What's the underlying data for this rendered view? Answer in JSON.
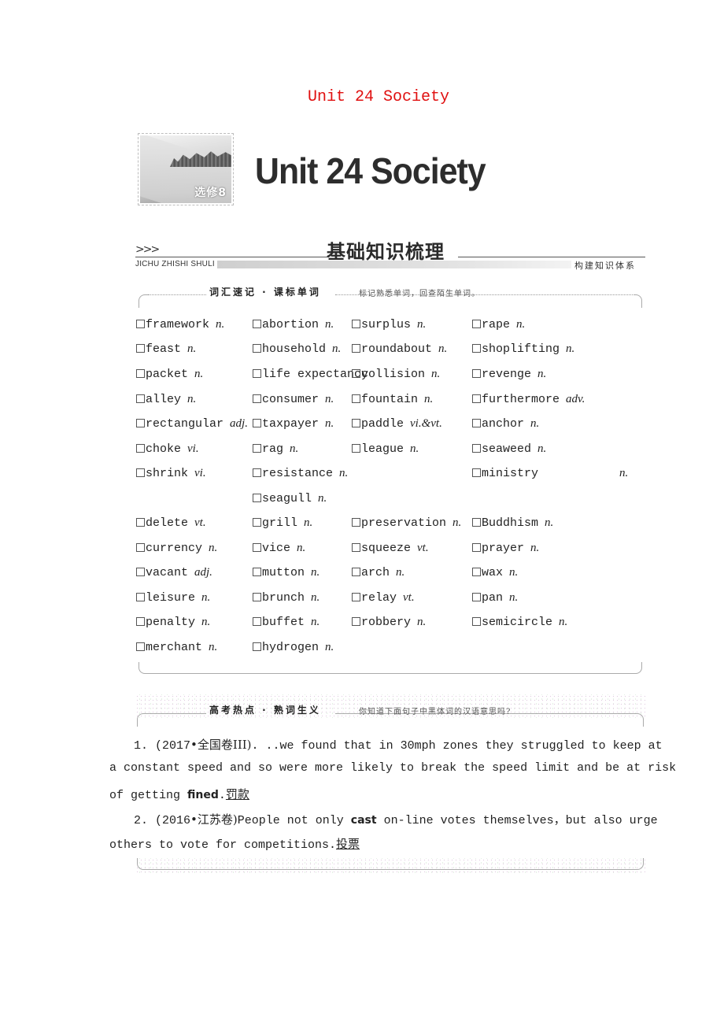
{
  "document": {
    "title": "Unit 24 Society",
    "banner": {
      "image_tag": "选修8",
      "image_icon": "snow-landscape-image",
      "heading": "Unit 24 Society"
    },
    "section_header": {
      "chevrons": ">>>",
      "title": "基础知识梳理",
      "pinyin": "JICHU ZHISHI SHULI",
      "subtitle": "构建知识体系"
    },
    "vocabulary": {
      "label": "词汇速记 · 课标单词",
      "hint": "标记熟悉单词，回查陌生单词。",
      "checkbox_glyph": "☐",
      "rows": [
        [
          {
            "word": "framework",
            "pos": "n."
          },
          {
            "word": "abortion",
            "pos": "n."
          },
          {
            "word": "surplus",
            "pos": "n."
          },
          {
            "word": "rape",
            "pos": "n."
          }
        ],
        [
          {
            "word": "feast",
            "pos": "n."
          },
          {
            "word": "household",
            "pos": "n."
          },
          {
            "word": "roundabout",
            "pos": "n."
          },
          {
            "word": "shoplifting",
            "pos": "n."
          }
        ],
        [
          {
            "word": "packet",
            "pos": "n."
          },
          {
            "word": "life expectancy",
            "pos": ""
          },
          {
            "word": "collision",
            "pos": "n."
          },
          {
            "word": "revenge",
            "pos": "n."
          }
        ],
        [
          {
            "word": "alley",
            "pos": "n."
          },
          {
            "word": "consumer",
            "pos": "n."
          },
          {
            "word": "fountain",
            "pos": "n."
          },
          {
            "word": "furthermore",
            "pos": "adv."
          }
        ],
        [
          {
            "word": "rectangular",
            "pos": "adj."
          },
          {
            "word": "taxpayer",
            "pos": "n."
          },
          {
            "word": "paddle",
            "pos": "vi.&vt."
          },
          {
            "word": "anchor",
            "pos": "n."
          }
        ],
        [
          {
            "word": "choke",
            "pos": "vi."
          },
          {
            "word": "rag",
            "pos": "n."
          },
          {
            "word": "league",
            "pos": "n."
          },
          {
            "word": "seaweed",
            "pos": "n."
          }
        ],
        [
          {
            "word": "shrink",
            "pos": "vi."
          },
          {
            "word": "resistance",
            "pos": "n."
          },
          null,
          {
            "word": "ministry",
            "pos": "n."
          }
        ],
        [
          null,
          {
            "word": "seagull",
            "pos": "n."
          },
          null,
          null
        ],
        [
          {
            "word": "delete",
            "pos": "vt."
          },
          {
            "word": "grill",
            "pos": "n."
          },
          {
            "word": "preservation",
            "pos": "n."
          },
          {
            "word": "Buddhism",
            "pos": "n."
          }
        ],
        [
          {
            "word": "currency",
            "pos": "n."
          },
          {
            "word": "vice",
            "pos": "n."
          },
          {
            "word": "squeeze",
            "pos": "vt."
          },
          {
            "word": "prayer",
            "pos": "n."
          }
        ],
        [
          {
            "word": "vacant",
            "pos": "adj."
          },
          {
            "word": "mutton",
            "pos": "n."
          },
          {
            "word": "arch",
            "pos": "n."
          },
          {
            "word": "wax",
            "pos": "n."
          }
        ],
        [
          {
            "word": "leisure",
            "pos": "n."
          },
          {
            "word": "brunch",
            "pos": "n."
          },
          {
            "word": "relay",
            "pos": "vt."
          },
          {
            "word": "pan",
            "pos": "n."
          }
        ],
        [
          {
            "word": "penalty",
            "pos": "n."
          },
          {
            "word": "buffet",
            "pos": "n."
          },
          {
            "word": "robbery",
            "pos": "n."
          },
          {
            "word": "semicircle",
            "pos": "n."
          }
        ],
        [
          {
            "word": "merchant",
            "pos": "n."
          },
          {
            "word": "hydrogen",
            "pos": "n."
          },
          null,
          null
        ]
      ]
    },
    "hot_topics": {
      "label": "高考热点 · 熟词生义",
      "hint": "你知道下面句子中黑体词的汉语意思吗?",
      "items": [
        {
          "number": "1.",
          "source_year": "(2017",
          "source_dot": "•",
          "source_name": "全国卷III)",
          "line1_rest": ". ..we found that in 30mph zones they struggled to keep at",
          "line2": "a constant speed and so were more likely to break the speed limit and be at risk",
          "line3_pre": "of getting ",
          "keyword": "fined",
          "line3_post": ".",
          "answer": "罚款"
        },
        {
          "number": "2.",
          "source_year": "(2016",
          "source_dot": "•",
          "source_name": "江苏卷)",
          "line1_pre": "People not only ",
          "keyword": "cast",
          "line1_post": " on-line votes themselves，but also urge",
          "line2": "others to vote for competitions.",
          "answer": "投票"
        }
      ]
    }
  }
}
